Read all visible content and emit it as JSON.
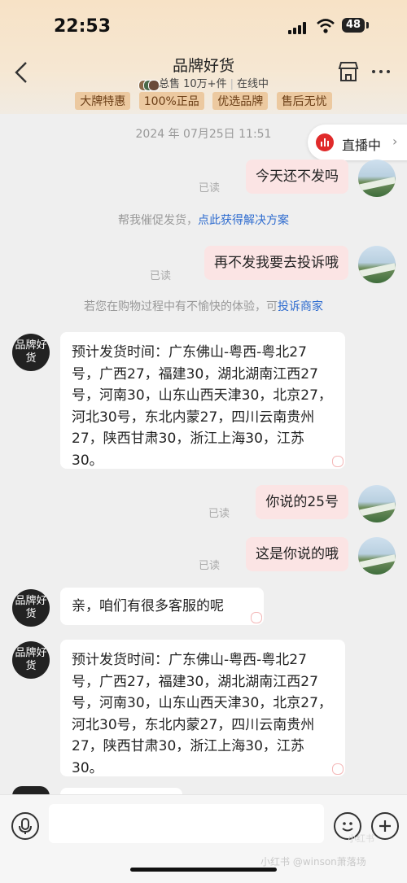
{
  "status_bar": {
    "time": "22:53",
    "battery": "48"
  },
  "header": {
    "title": "品牌好货",
    "sales": "总售 10万+件",
    "online": "在线中",
    "tags": [
      "大牌特惠",
      "100%正品",
      "优选品牌",
      "售后无忧"
    ]
  },
  "chat": {
    "timestamp": "2024 年 07月25日 11:51",
    "live_label": "直播中",
    "read_label": "已读",
    "shop_avatar_text": "品牌好货",
    "messages": [
      {
        "from": "me",
        "text": "今天还不发吗"
      },
      {
        "from": "me",
        "text": "再不发我要去投诉哦"
      },
      {
        "from": "shop",
        "text": "预计发货时间：广东佛山-粤西-粤北27号，广西27，福建30，湖北湖南江西27号，河南30，山东山西天津30，北京27，河北30号，东北内蒙27，四川云南贵州27，陕西甘肃30，浙江上海30，江苏30。"
      },
      {
        "from": "me",
        "text": "你说的25号"
      },
      {
        "from": "me",
        "text": "这是你说的哦"
      },
      {
        "from": "shop",
        "text": "亲，咱们有很多客服的呢"
      },
      {
        "from": "shop",
        "text": "预计发货时间：广东佛山-粤西-粤北27号，广西27，福建30，湖北湖南江西27号，河南30，山东山西天津30，北京27，河北30号，东北内蒙27，四川云南贵州27，陕西甘肃30，浙江上海30，江苏30。"
      }
    ],
    "system_1": {
      "text": "帮我催促发货，",
      "link": "点此获得解决方案"
    },
    "system_2": {
      "text": "若您在购物过程中有不愉快的体验，可",
      "link": "投诉商家"
    }
  },
  "watermark": "小红书 @winson萧落场"
}
